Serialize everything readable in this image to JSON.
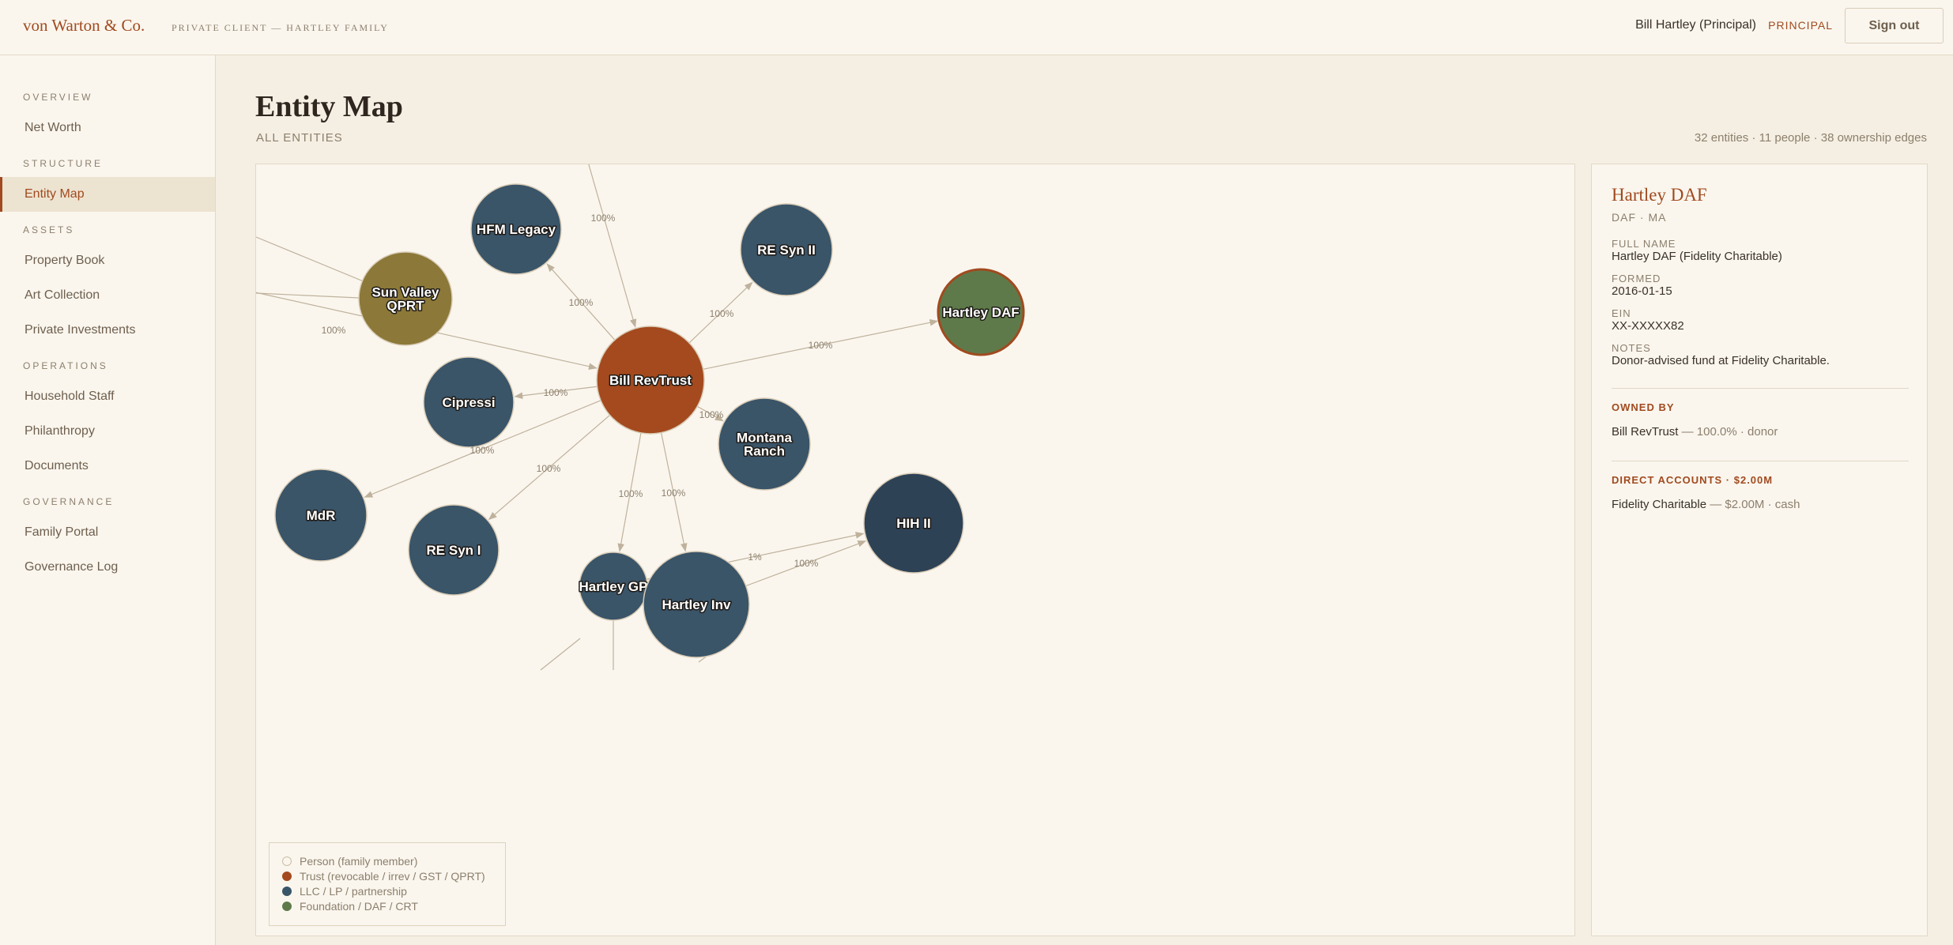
{
  "header": {
    "brand": "von Warton & Co.",
    "tagline": "PRIVATE CLIENT — HARTLEY FAMILY",
    "user_name": "Bill Hartley (Principal)",
    "user_role": "PRINCIPAL",
    "signout_label": "Sign out"
  },
  "sidebar": {
    "sections": [
      {
        "title": "OVERVIEW",
        "items": [
          {
            "label": "Net Worth"
          }
        ]
      },
      {
        "title": "STRUCTURE",
        "items": [
          {
            "label": "Entity Map",
            "active": true
          }
        ]
      },
      {
        "title": "ASSETS",
        "items": [
          {
            "label": "Property Book"
          },
          {
            "label": "Art Collection"
          },
          {
            "label": "Private Investments"
          }
        ]
      },
      {
        "title": "OPERATIONS",
        "items": [
          {
            "label": "Household Staff"
          },
          {
            "label": "Philanthropy"
          },
          {
            "label": "Documents"
          }
        ]
      },
      {
        "title": "GOVERNANCE",
        "items": [
          {
            "label": "Family Portal"
          },
          {
            "label": "Governance Log"
          }
        ]
      }
    ]
  },
  "page": {
    "title": "Entity Map",
    "subtitle": "ALL ENTITIES",
    "stats": "32 entities · 11 people · 38 ownership edges"
  },
  "graph": {
    "colors": {
      "person": "#faf6ee",
      "trust": "#a44a1e",
      "trust_gold": "#8c7838",
      "llc": "#3a5468",
      "llc_dark": "#2e4256",
      "foundation": "#5e7a4a",
      "edge": "#bfb29c",
      "selected_ring": "#a14a1f"
    },
    "nodes": [
      {
        "id": "bill-revtrust",
        "label": "Bill RevTrust",
        "kind": "trust"
      },
      {
        "id": "hfm-legacy",
        "label": "HFM Legacy",
        "kind": "llc"
      },
      {
        "id": "re-syn-ii",
        "label": "RE Syn II",
        "kind": "llc"
      },
      {
        "id": "sun-valley-qprt",
        "label": "Sun Valley QPRT",
        "lines": [
          "Sun Valley",
          "QPRT"
        ],
        "kind": "trust_gold"
      },
      {
        "id": "hartley-daf",
        "label": "Hartley DAF",
        "kind": "foundation",
        "selected": true
      },
      {
        "id": "cipressi",
        "label": "Cipressi",
        "kind": "llc"
      },
      {
        "id": "montana-ranch",
        "label": "Montana Ranch",
        "lines": [
          "Montana",
          "Ranch"
        ],
        "kind": "llc"
      },
      {
        "id": "mdr",
        "label": "MdR",
        "kind": "llc"
      },
      {
        "id": "re-syn-i",
        "label": "RE Syn I",
        "kind": "llc"
      },
      {
        "id": "hih-ii",
        "label": "HIH II",
        "kind": "llc_dark"
      },
      {
        "id": "hartley-gp",
        "label": "Hartley GP",
        "kind": "llc"
      },
      {
        "id": "hartley-inv",
        "label": "Hartley Inv",
        "kind": "llc"
      }
    ],
    "edges": [
      {
        "from": "bill-revtrust",
        "to": "hfm-legacy",
        "label": "100%"
      },
      {
        "from": "bill-revtrust",
        "to": "re-syn-ii",
        "label": "100%"
      },
      {
        "from": "bill-revtrust",
        "to": "hartley-daf",
        "label": "100%"
      },
      {
        "from": "bill-revtrust",
        "to": "cipressi",
        "label": "100%"
      },
      {
        "from": "bill-revtrust",
        "to": "montana-ranch",
        "label": "100%"
      },
      {
        "from": "bill-revtrust",
        "to": "mdr",
        "label": "100%"
      },
      {
        "from": "bill-revtrust",
        "to": "re-syn-i",
        "label": "100%"
      },
      {
        "from": "bill-revtrust",
        "to": "hartley-gp",
        "label": "100%"
      },
      {
        "from": "bill-revtrust",
        "to": "hartley-inv",
        "label": "100%"
      },
      {
        "from": "off-top",
        "to": "bill-revtrust",
        "label": "100%"
      },
      {
        "from": "off-left",
        "to": "bill-revtrust",
        "label": "100%"
      },
      {
        "from": "hartley-gp",
        "to": "hih-ii",
        "label": "1%"
      },
      {
        "from": "hartley-inv",
        "to": "hih-ii",
        "label": "100%"
      }
    ]
  },
  "legend": [
    {
      "label": "Person (family member)",
      "color": "#faf6ee"
    },
    {
      "label": "Trust (revocable / irrev / GST / QPRT)",
      "color": "#a44a1e"
    },
    {
      "label": "LLC / LP / partnership",
      "color": "#3a5468"
    },
    {
      "label": "Foundation / DAF / CRT",
      "color": "#5e7a4a"
    }
  ],
  "detail": {
    "title": "Hartley DAF",
    "subtitle": "DAF · MA",
    "fields": [
      {
        "label": "FULL NAME",
        "value": "Hartley DAF (Fidelity Charitable)"
      },
      {
        "label": "FORMED",
        "value": "2016-01-15"
      },
      {
        "label": "EIN",
        "value": "XX-XXXXX82"
      },
      {
        "label": "NOTES",
        "value": "Donor-advised fund at Fidelity Charitable."
      }
    ],
    "owned_by_title": "OWNED BY",
    "owned_by": {
      "name": "Bill RevTrust",
      "detail": " — 100.0% · donor"
    },
    "accounts_title": "DIRECT ACCOUNTS · $2.00M",
    "accounts": {
      "name": "Fidelity Charitable",
      "detail": " — $2.00M · cash"
    }
  }
}
